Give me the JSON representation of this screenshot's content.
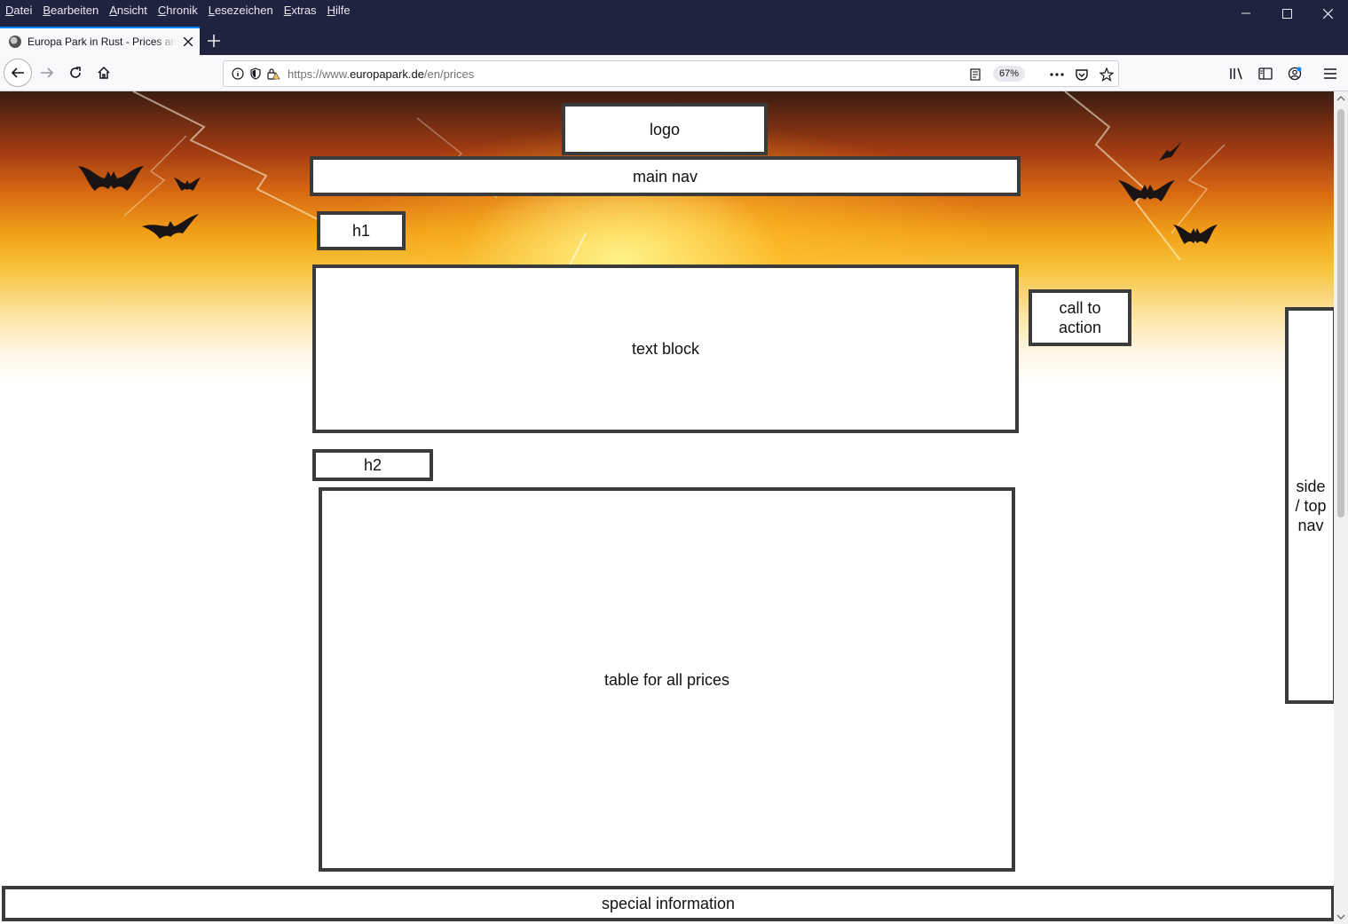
{
  "browser": {
    "menu": [
      "Datei",
      "Bearbeiten",
      "Ansicht",
      "Chronik",
      "Lesezeichen",
      "Extras",
      "Hilfe"
    ],
    "tab_title": "Europa Park in Rust - Prices and",
    "url": {
      "prefix": "https://www.",
      "domain": "europapark.de",
      "path": "/en/prices"
    },
    "zoom": "67%"
  },
  "wireframe": {
    "logo": "logo",
    "main_nav": "main nav",
    "h1": "h1",
    "text_block": "text block",
    "call_to_action": "call to action",
    "h2": "h2",
    "price_table": "table for all prices",
    "side_nav": "side / top nav",
    "special_info": "special information"
  },
  "colors": {
    "titlebar": "#202340",
    "wire_border": "#3b3b3b",
    "accent": "#0a84ff"
  }
}
